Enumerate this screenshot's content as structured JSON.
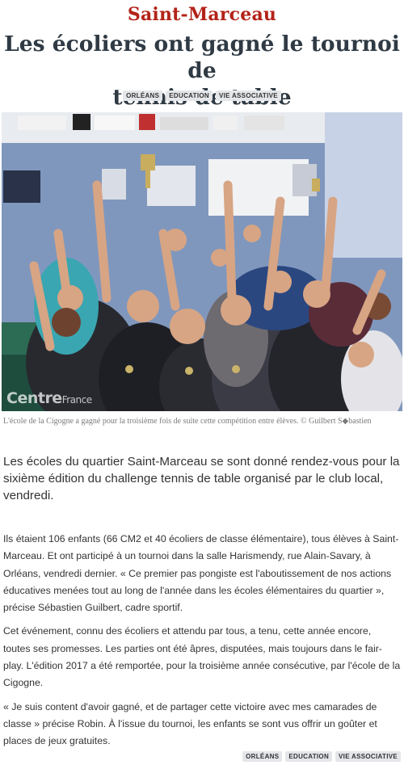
{
  "article": {
    "kicker": "Saint-Marceau",
    "headline_line1": "Les écoliers ont gagné le tournoi de",
    "headline_line2": "tennis de table",
    "tags": [
      "ORLÉANS",
      "EDUCATION",
      "VIE ASSOCIATIVE"
    ],
    "photo": {
      "description_icon": "group-photo-children-trophies",
      "watermark": "Centre",
      "watermark_small": "France"
    },
    "caption": "L'école de la Cigogne a gagné pour la troisième fois de suite cette compétition entre élèves. © Guilbert S◆bastien",
    "lead": "Les écoles du quartier Saint-Marceau se sont donné rendez-vous pour la sixième édition du challenge tennis de table organisé par le club local, vendredi.",
    "paragraphs": [
      "Ils étaient 106 enfants (66 CM2 et 40 écoliers de classe élémentaire), tous élèves à Saint-Marceau. Et ont participé à un tournoi dans la salle Harismendy, rue Alain-Savary, à Orléans, vendredi dernier. « Ce premier pas pongiste est l'aboutissement de nos actions éducatives menées tout au long de l'année dans les écoles élémentaires du quartier », précise Sébastien Guilbert, cadre sportif.",
      "Cet événement, connu des écoliers et attendu par tous, a tenu, cette année encore, toutes ses promesses. Les parties ont été âpres, disputées, mais toujours dans le fair-play. L'édition 2017 a été remportée, pour la troisième année consécutive, par l'école de la Cigogne.",
      "« Je suis content d'avoir gagné, et de partager cette victoire avec mes camarades de classe » précise Robin. À l'issue du tournoi, les enfants se sont vus offrir un goûter et places de jeux gratuites."
    ]
  }
}
